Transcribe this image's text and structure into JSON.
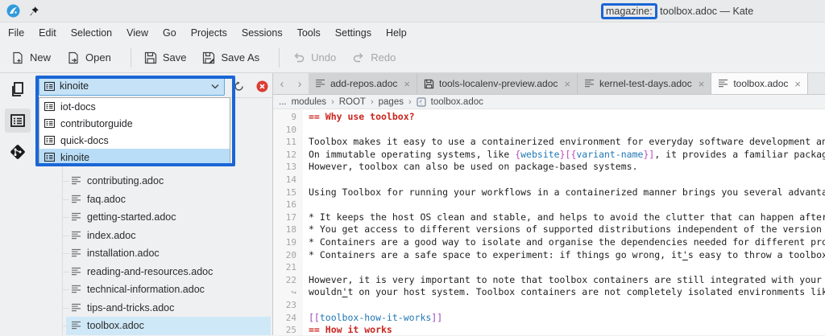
{
  "titlebar": {
    "title_prefix": "magazine:",
    "title_suffix": " toolbox.adoc — Kate"
  },
  "menubar": [
    "File",
    "Edit",
    "Selection",
    "View",
    "Go",
    "Projects",
    "Sessions",
    "Tools",
    "Settings",
    "Help"
  ],
  "toolbar": [
    {
      "label": "New",
      "icon": "new",
      "enabled": true,
      "sep_before": false
    },
    {
      "label": "Open",
      "icon": "open",
      "enabled": true,
      "sep_before": false
    },
    {
      "label": "Save",
      "icon": "save",
      "enabled": true,
      "sep_before": true
    },
    {
      "label": "Save As",
      "icon": "saveas",
      "enabled": true,
      "sep_before": false
    },
    {
      "label": "Undo",
      "icon": "undo",
      "enabled": false,
      "sep_before": true
    },
    {
      "label": "Redo",
      "icon": "redo",
      "enabled": false,
      "sep_before": false
    }
  ],
  "side_tools": [
    {
      "name": "documents",
      "icon": "copy-pages",
      "active": false
    },
    {
      "name": "projects",
      "icon": "list-box",
      "active": true
    },
    {
      "name": "git",
      "icon": "git",
      "active": false
    }
  ],
  "project_panel": {
    "combo_value": "kinoite",
    "actions": [
      "refresh",
      "close-project"
    ],
    "dropdown_items": [
      "iot-docs",
      "contributorguide",
      "quick-docs",
      "kinoite"
    ],
    "dropdown_selected": 3,
    "tree_items": [
      "contributing.adoc",
      "faq.adoc",
      "getting-started.adoc",
      "index.adoc",
      "installation.adoc",
      "reading-and-resources.adoc",
      "technical-information.adoc",
      "tips-and-tricks.adoc",
      "toolbox.adoc"
    ],
    "tree_selected": 8
  },
  "tabs": [
    {
      "label": "add-repos.adoc",
      "modified": false,
      "active": false
    },
    {
      "label": "tools-localenv-preview.adoc",
      "modified": true,
      "active": false
    },
    {
      "label": "kernel-test-days.adoc",
      "modified": false,
      "active": false
    },
    {
      "label": "toolbox.adoc",
      "modified": false,
      "active": true
    }
  ],
  "breadcrumb": {
    "ellipsis": "...",
    "segments": [
      "modules",
      "ROOT",
      "pages"
    ],
    "file": "toolbox.adoc"
  },
  "editor_lines": [
    {
      "n": "9",
      "seg": [
        {
          "t": "== Why use toolbox?",
          "c": "h"
        }
      ]
    },
    {
      "n": "10",
      "seg": []
    },
    {
      "n": "11",
      "seg": [
        {
          "t": "Toolbox makes it easy to use a containerized environment for everyday software development and debugging."
        }
      ]
    },
    {
      "n": "12",
      "seg": [
        {
          "t": "On immutable operating systems, like "
        },
        {
          "t": "{",
          "c": "m"
        },
        {
          "t": "website",
          "c": "b"
        },
        {
          "t": "}[{",
          "c": "m"
        },
        {
          "t": "variant-name",
          "c": "b"
        },
        {
          "t": "}]",
          "c": "m"
        },
        {
          "t": ", it provides a familiar package-based workflow."
        }
      ]
    },
    {
      "n": "13",
      "seg": [
        {
          "t": "However, toolbox can also be used on package-based systems."
        }
      ]
    },
    {
      "n": "14",
      "seg": []
    },
    {
      "n": "15",
      "seg": [
        {
          "t": "Using Toolbox for running your workflows in a containerized manner brings you several advantages:"
        }
      ]
    },
    {
      "n": "16",
      "seg": []
    },
    {
      "n": "17",
      "seg": [
        {
          "t": "* It keeps the host OS clean and stable, and helps to avoid the clutter that can happen after installing"
        }
      ]
    },
    {
      "n": "18",
      "seg": [
        {
          "t": "* You get access to different versions of supported distributions independent of the version you run"
        }
      ]
    },
    {
      "n": "19",
      "seg": [
        {
          "t": "* Containers are a good way to isolate and organise the dependencies needed for different projects"
        }
      ]
    },
    {
      "n": "20",
      "seg": [
        {
          "t": "* Containers are a safe space to experiment: if things go wrong, it"
        },
        {
          "t": "'",
          "c": "u"
        },
        {
          "t": "s easy to throw a toolbox away and start fresh."
        }
      ]
    },
    {
      "n": "21",
      "seg": []
    },
    {
      "n": "22",
      "seg": [
        {
          "t": "However, it is very important to note that toolbox containers are still integrated with your host system"
        }
      ]
    },
    {
      "n": "↪",
      "wrap": true,
      "seg": [
        {
          "t": "wouldn"
        },
        {
          "t": "'",
          "c": "u"
        },
        {
          "t": "t on your host system. Toolbox containers are not completely isolated environments like virtual machines."
        }
      ]
    },
    {
      "n": "23",
      "seg": []
    },
    {
      "n": "24",
      "seg": [
        {
          "t": "[[",
          "c": "p"
        },
        {
          "t": "toolbox-how-it-works",
          "c": "b"
        },
        {
          "t": "]]",
          "c": "p"
        }
      ]
    },
    {
      "n": "25",
      "seg": [
        {
          "t": "== How it works",
          "c": "h"
        }
      ]
    }
  ],
  "colors": {
    "annotation_blue": "#1a66d6",
    "selection_blue": "#cfe8f8",
    "combo_focus": "#c5e2f7",
    "heading_red": "#ca2620",
    "attr_magenta": "#bf46bf",
    "ref_blue": "#2077b4",
    "anchor_purple": "#9745be",
    "close_red": "#dd3b31"
  }
}
